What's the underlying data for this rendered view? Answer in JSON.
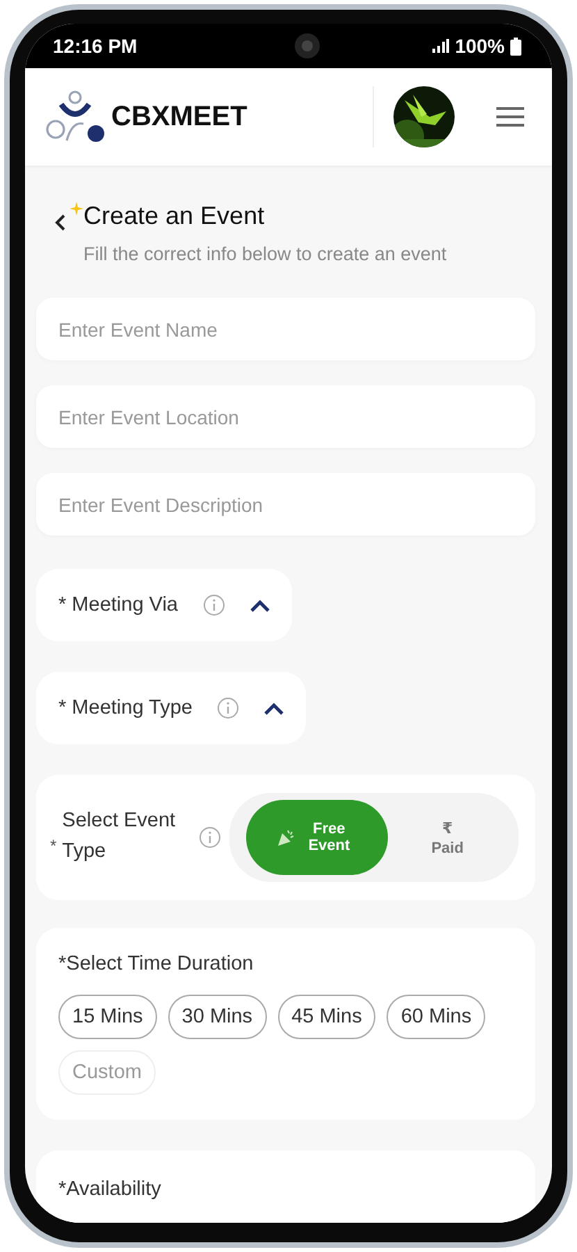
{
  "status_bar": {
    "time": "12:16 PM",
    "battery": "100%"
  },
  "header": {
    "brand": "CBXMEET"
  },
  "page": {
    "title": "Create an Event",
    "subtitle": "Fill the correct info below to create an event"
  },
  "fields": [
    {
      "placeholder": "Enter Event Name"
    },
    {
      "placeholder": "Enter Event Location"
    },
    {
      "placeholder": "Enter Event Description"
    }
  ],
  "dropdowns": [
    {
      "label": "* Meeting Via",
      "expanded": true
    },
    {
      "label": "* Meeting Type",
      "expanded": true
    }
  ],
  "event_type": {
    "label": "Select Event Type",
    "required_mark": "*",
    "options": [
      {
        "kind": "free",
        "label": "Free Event",
        "selected": true
      },
      {
        "kind": "paid",
        "symbol": "₹",
        "label": "Paid",
        "selected": false
      }
    ]
  },
  "duration": {
    "label": "*Select Time Duration",
    "options": [
      {
        "kind": "preset",
        "label": "15 Mins"
      },
      {
        "kind": "preset",
        "label": "30 Mins"
      },
      {
        "kind": "preset",
        "label": "45 Mins"
      },
      {
        "kind": "preset",
        "label": "60 Mins"
      },
      {
        "kind": "custom",
        "label": "Custom"
      }
    ]
  },
  "availability": {
    "label": "*Availability"
  }
}
